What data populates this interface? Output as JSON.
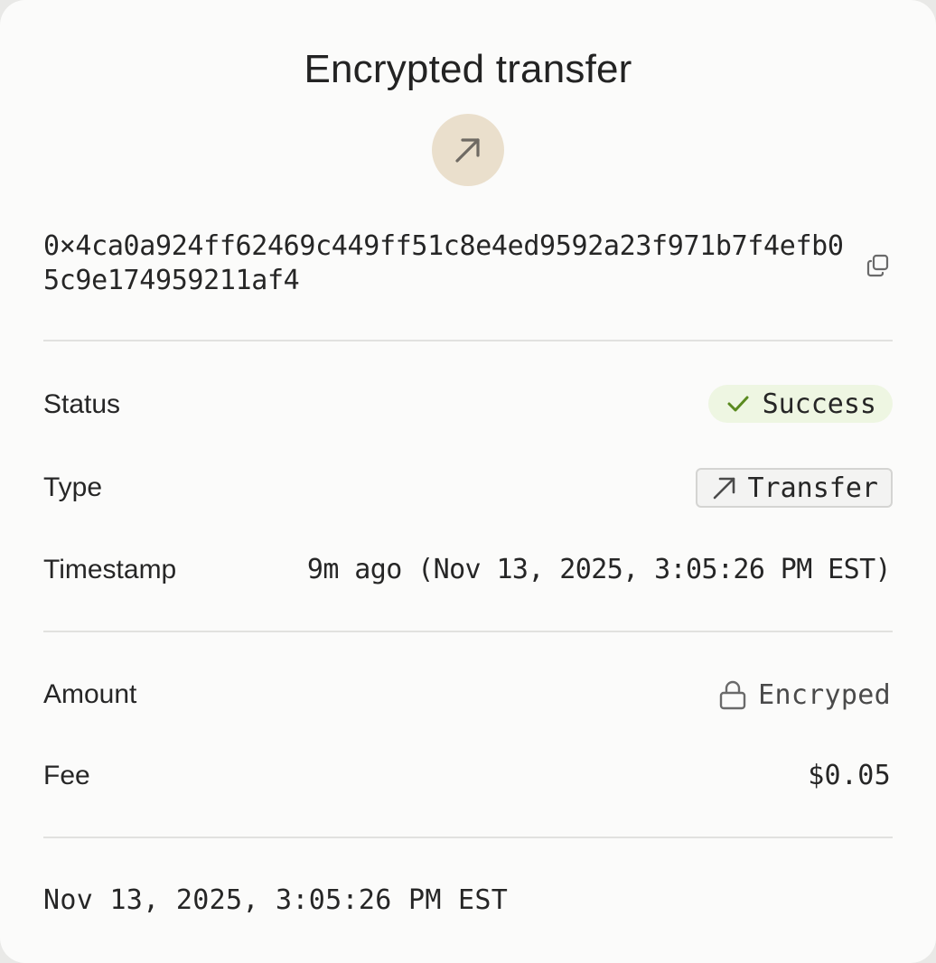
{
  "header": {
    "title": "Encrypted transfer",
    "icon": "arrow-up-right-icon",
    "icon_bg": "#eadfcc"
  },
  "transaction": {
    "hash": "0×4ca0a924ff62469c449ff51c8e4ed9592a23f971b7f4efb05c9e174959211af4",
    "copy_icon": "copy-icon"
  },
  "details": {
    "status_label": "Status",
    "status_value": "Success",
    "status_icon": "checkmark-icon",
    "status_color": "#5a8a1f",
    "type_label": "Type",
    "type_value": "Transfer",
    "type_icon": "arrow-up-right-icon",
    "timestamp_label": "Timestamp",
    "timestamp_value": "9m ago (Nov 13, 2025, 3:05:26 PM EST)"
  },
  "amounts": {
    "amount_label": "Amount",
    "amount_value": "Encryped",
    "amount_icon": "lock-icon",
    "fee_label": "Fee",
    "fee_value": "$0.05"
  },
  "footer": {
    "date": "Nov 13, 2025, 3:05:26 PM EST"
  }
}
